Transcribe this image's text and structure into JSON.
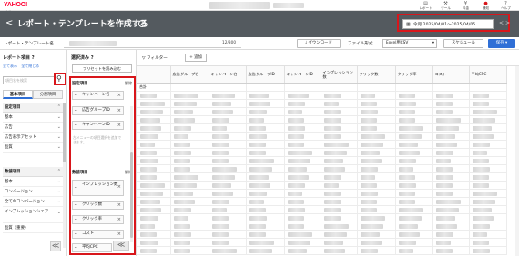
{
  "header": {
    "logo_text": "YAHOO!",
    "logo_sub": "広告",
    "nav": [
      {
        "icon": "report-icon",
        "glyph": "▤",
        "label": "レポート"
      },
      {
        "icon": "tool-icon",
        "glyph": "⚒",
        "label": "ツール"
      },
      {
        "icon": "billing-icon",
        "glyph": "¥",
        "label": "料金"
      },
      {
        "icon": "notification-icon",
        "glyph": "🔔",
        "label": "通知"
      },
      {
        "icon": "help-icon",
        "glyph": "?",
        "label": "ヘルプ"
      }
    ]
  },
  "titlebar": {
    "back": "<",
    "title": "レポート・テンプレートを作成する",
    "help": "?",
    "date_range": "今月 2025/04/01〜2025/04/05",
    "prev": "<",
    "next": ">"
  },
  "toolbar": {
    "name_label": "レポート・テンプレート名",
    "char_count": "12/300",
    "download": "⤓ ダウンロード",
    "file_format_label": "ファイル形式",
    "file_format_value": "Excel用CSV",
    "schedule": "スケジュール",
    "save": "保存"
  },
  "left_panel": {
    "title": "レポート項目",
    "help": "?",
    "links": [
      "全て表示",
      "全て閉じる"
    ],
    "search_placeholder": "項目名を検索",
    "tabs": [
      "基本項目",
      "分割項目"
    ],
    "groups": [
      {
        "name": "設定項目",
        "items": [
          "基本",
          "広告",
          "広告表示アセット",
          "品質"
        ]
      },
      {
        "name": "数値項目",
        "items": [
          "基本",
          "コンバージョン",
          "全てのコンバージョン",
          "インプレッションシェア",
          "品質（重要）"
        ]
      }
    ],
    "collapse": "≪"
  },
  "selected_panel": {
    "title": "選択済み",
    "help": "?",
    "preset_button": "プリセットを読み込む",
    "setting_section": "設定項目",
    "clear": "解除",
    "setting_items": [
      "キャンペーン名",
      "広告グループID",
      "キャンペーンID"
    ],
    "note": "左メニューの項目選択を追加できます。",
    "numeric_section": "数値項目",
    "numeric_items": [
      "インプレッション数",
      "クリック数",
      "クリック率",
      "コスト",
      "平均CPC"
    ],
    "collapse": "≪"
  },
  "grid": {
    "filter_label": "▽ フィルター",
    "add_label": "+ 追加",
    "first_row_label": "合計",
    "columns": [
      "",
      "広告グループ名",
      "キャンペーン名",
      "広告グループID",
      "キャンペーンID",
      "インプレッション数",
      "クリック数",
      "クリック率",
      "コスト",
      "平均CPC"
    ]
  },
  "colors": {
    "titlebar_bg": "#545a5f",
    "highlight": "#d8161b",
    "primary": "#2f6fd6"
  }
}
